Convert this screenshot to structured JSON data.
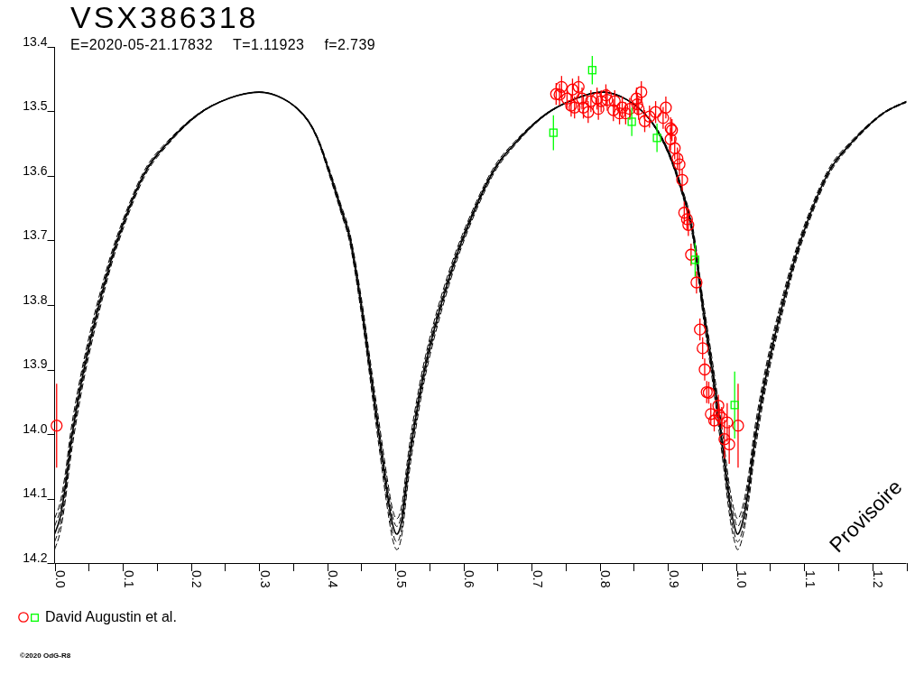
{
  "chart_data": {
    "type": "scatter",
    "title": "VSX386318",
    "xlim": [
      0,
      1.25
    ],
    "ylim": [
      14.2,
      13.4
    ],
    "xticks": [
      {
        "value": 0,
        "label": "0.0"
      },
      {
        "value": 0.1,
        "label": "0.1"
      },
      {
        "value": 0.2,
        "label": "0.2"
      },
      {
        "value": 0.3,
        "label": "0.3"
      },
      {
        "value": 0.4,
        "label": "0.4"
      },
      {
        "value": 0.5,
        "label": "0.5"
      },
      {
        "value": 0.6,
        "label": "0.6"
      },
      {
        "value": 0.7,
        "label": "0.7"
      },
      {
        "value": 0.8,
        "label": "0.8"
      },
      {
        "value": 0.9,
        "label": "0.9"
      },
      {
        "value": 1.0,
        "label": "1.0"
      },
      {
        "value": 1.1,
        "label": "1.1"
      },
      {
        "value": 1.2,
        "label": "1.2"
      }
    ],
    "yticks": [
      {
        "value": 13.4,
        "label": "13.4"
      },
      {
        "value": 13.5,
        "label": "13.5"
      },
      {
        "value": 13.6,
        "label": "13.6"
      },
      {
        "value": 13.7,
        "label": "13.7"
      },
      {
        "value": 13.8,
        "label": "13.8"
      },
      {
        "value": 13.9,
        "label": "13.9"
      },
      {
        "value": 14.0,
        "label": "14.0"
      },
      {
        "value": 14.1,
        "label": "14.1"
      },
      {
        "value": 14.2,
        "label": "14.2"
      }
    ],
    "x": [
      0,
      0.008,
      0.016,
      0.026,
      0.043,
      0.065,
      0.092,
      0.13,
      0.165,
      0.21,
      0.255,
      0.3,
      0.335,
      0.365,
      0.385,
      0.405,
      0.42,
      0.434,
      0.45,
      0.463,
      0.476,
      0.488,
      0.496,
      0.503,
      0.51,
      0.518,
      0.526,
      0.543,
      0.567,
      0.598,
      0.64,
      0.675,
      0.72,
      0.765,
      0.805,
      0.84,
      0.873,
      0.899,
      0.921,
      0.937,
      0.951,
      0.965,
      0.978,
      0.99,
      0.997,
      1.003,
      1.011,
      1.019,
      1.029,
      1.046,
      1.068,
      1.095,
      1.133,
      1.168,
      1.213,
      1.25
    ],
    "series": [
      {
        "type": "line",
        "line_style": "dashed",
        "color": "#000000",
        "values": [
          14.179,
          14.153,
          14.101,
          14.019,
          13.915,
          13.812,
          13.708,
          13.605,
          13.553,
          13.506,
          13.48,
          13.47,
          13.48,
          13.506,
          13.542,
          13.605,
          13.656,
          13.708,
          13.812,
          13.915,
          14.019,
          14.112,
          14.163,
          14.179,
          14.153,
          14.081,
          14.019,
          13.915,
          13.812,
          13.708,
          13.605,
          13.553,
          13.506,
          13.48,
          13.47,
          13.482,
          13.513,
          13.562,
          13.629,
          13.698,
          13.812,
          13.915,
          14.019,
          14.122,
          14.163,
          14.179,
          14.153,
          14.101,
          14.019,
          13.915,
          13.812,
          13.708,
          13.605,
          13.553,
          13.506,
          13.486
        ]
      },
      {
        "type": "line",
        "line_style": "dashed",
        "color": "#000000",
        "values": [
          14.167,
          14.142,
          14.091,
          14.009,
          13.908,
          13.806,
          13.704,
          13.602,
          13.551,
          13.506,
          13.48,
          13.47,
          13.48,
          13.506,
          13.541,
          13.602,
          13.653,
          13.704,
          13.806,
          13.908,
          14.009,
          14.101,
          14.152,
          14.167,
          14.142,
          14.07,
          14.009,
          13.908,
          13.806,
          13.704,
          13.602,
          13.551,
          13.506,
          13.48,
          13.47,
          13.482,
          13.513,
          13.561,
          13.627,
          13.694,
          13.806,
          13.908,
          14.009,
          14.111,
          14.152,
          14.167,
          14.142,
          14.091,
          14.009,
          13.908,
          13.806,
          13.704,
          13.602,
          13.551,
          13.506,
          13.485
        ]
      },
      {
        "type": "line",
        "line_style": "dashed",
        "color": "#000000",
        "values": [
          14.143,
          14.118,
          14.069,
          13.991,
          13.892,
          13.794,
          13.696,
          13.598,
          13.549,
          13.504,
          13.48,
          13.47,
          13.48,
          13.504,
          13.539,
          13.598,
          13.647,
          13.696,
          13.794,
          13.892,
          13.991,
          14.079,
          14.128,
          14.143,
          14.118,
          14.05,
          13.991,
          13.892,
          13.794,
          13.696,
          13.598,
          13.549,
          13.504,
          13.48,
          13.47,
          13.482,
          13.511,
          13.557,
          13.621,
          13.686,
          13.794,
          13.892,
          13.991,
          14.089,
          14.128,
          14.143,
          14.118,
          14.069,
          13.991,
          13.892,
          13.794,
          13.696,
          13.598,
          13.549,
          13.504,
          13.485
        ]
      },
      {
        "type": "line",
        "line_style": "dashed",
        "color": "#000000",
        "values": [
          14.131,
          14.107,
          14.059,
          13.981,
          13.885,
          13.788,
          13.692,
          13.595,
          13.547,
          13.504,
          13.48,
          13.47,
          13.48,
          13.504,
          13.538,
          13.595,
          13.644,
          13.692,
          13.788,
          13.885,
          13.981,
          14.068,
          14.117,
          14.131,
          14.107,
          14.039,
          13.981,
          13.885,
          13.788,
          13.692,
          13.595,
          13.547,
          13.504,
          13.48,
          13.47,
          13.482,
          13.511,
          13.556,
          13.619,
          13.682,
          13.788,
          13.885,
          13.981,
          14.078,
          14.117,
          14.131,
          14.107,
          14.059,
          13.981,
          13.885,
          13.788,
          13.692,
          13.595,
          13.547,
          13.504,
          13.484
        ]
      },
      {
        "type": "line",
        "color": "#000000",
        "values": [
          14.155,
          14.13,
          14.08,
          14.0,
          13.9,
          13.8,
          13.7,
          13.6,
          13.55,
          13.505,
          13.48,
          13.47,
          13.48,
          13.505,
          13.54,
          13.6,
          13.65,
          13.7,
          13.8,
          13.9,
          14.0,
          14.09,
          14.14,
          14.155,
          14.13,
          14.06,
          14.0,
          13.9,
          13.8,
          13.7,
          13.6,
          13.55,
          13.505,
          13.48,
          13.47,
          13.482,
          13.512,
          13.559,
          13.624,
          13.69,
          13.8,
          13.9,
          14.0,
          14.1,
          14.14,
          14.155,
          14.13,
          14.08,
          14.0,
          13.9,
          13.8,
          13.7,
          13.6,
          13.55,
          13.505,
          13.485
        ]
      },
      {
        "name": "David Augustin et al.",
        "type": "scatter",
        "marker": "circle",
        "color": "#ff0000",
        "x": [
          0.003,
          0.736,
          0.744,
          0.741,
          0.752,
          0.758,
          0.763,
          0.769,
          0.76,
          0.774,
          0.776,
          0.783,
          0.787,
          0.796,
          0.798,
          0.802,
          0.809,
          0.811,
          0.82,
          0.822,
          0.829,
          0.833,
          0.838,
          0.844,
          0.855,
          0.854,
          0.861,
          0.857,
          0.866,
          0.873,
          0.882,
          0.897,
          0.893,
          0.904,
          0.906,
          0.904,
          0.91,
          0.914,
          0.917,
          0.921,
          0.924,
          0.928,
          0.93,
          0.934,
          0.942,
          0.947,
          0.951,
          0.954,
          0.957,
          0.96,
          0.963,
          0.968,
          0.974,
          0.975,
          0.979,
          0.987,
          0.983,
          0.99,
          1.003
        ],
        "values": [
          13.987,
          13.473,
          13.462,
          13.474,
          13.48,
          13.491,
          13.494,
          13.462,
          13.466,
          13.48,
          13.494,
          13.501,
          13.484,
          13.48,
          13.496,
          13.484,
          13.475,
          13.482,
          13.498,
          13.484,
          13.503,
          13.494,
          13.503,
          13.496,
          13.489,
          13.48,
          13.47,
          13.496,
          13.515,
          13.508,
          13.501,
          13.494,
          13.51,
          13.526,
          13.529,
          13.543,
          13.557,
          13.573,
          13.582,
          13.606,
          13.657,
          13.667,
          13.676,
          13.722,
          13.765,
          13.838,
          13.867,
          13.9,
          13.935,
          13.936,
          13.969,
          13.979,
          13.956,
          13.97,
          13.975,
          13.982,
          14.008,
          14.016,
          13.987
        ],
        "errors": [
          0.065,
          0.017,
          0.017,
          0.017,
          0.017,
          0.017,
          0.017,
          0.017,
          0.017,
          0.017,
          0.017,
          0.017,
          0.017,
          0.017,
          0.017,
          0.017,
          0.017,
          0.017,
          0.017,
          0.017,
          0.017,
          0.017,
          0.017,
          0.017,
          0.017,
          0.017,
          0.017,
          0.017,
          0.017,
          0.017,
          0.017,
          0.017,
          0.017,
          0.017,
          0.017,
          0.017,
          0.017,
          0.017,
          0.017,
          0.017,
          0.017,
          0.017,
          0.017,
          0.017,
          0.017,
          0.017,
          0.017,
          0.017,
          0.017,
          0.017,
          0.017,
          0.017,
          0.017,
          0.017,
          0.017,
          0.03,
          0.03,
          0.03,
          0.065
        ]
      },
      {
        "type": "scatter",
        "marker": "square",
        "color": "#00ff00",
        "x": [
          0.732,
          0.789,
          0.847,
          0.884,
          0.94,
          0.998
        ],
        "values": [
          13.533,
          13.436,
          13.516,
          13.541,
          13.73,
          13.955
        ],
        "errors": [
          0.027,
          0.022,
          0.022,
          0.022,
          0.026,
          0.052
        ]
      }
    ],
    "annotations": [
      "Provisoire"
    ]
  },
  "parameters": [
    "E=2020-05-21.17832",
    "T=1.11923",
    "f=2.739"
  ],
  "copyright": "©2020 OdG-R8"
}
